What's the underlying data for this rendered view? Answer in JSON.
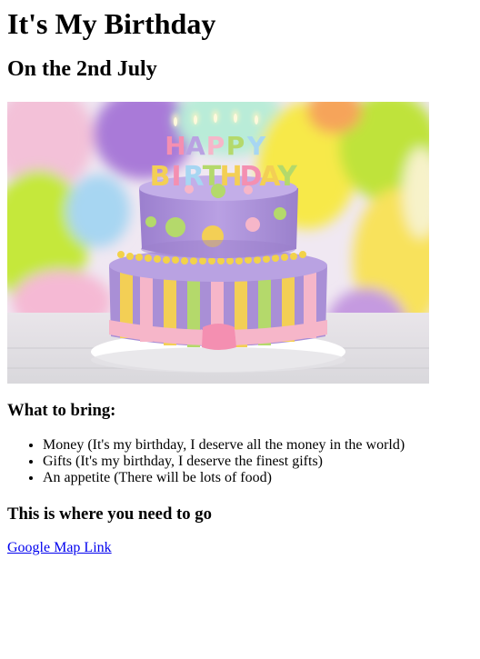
{
  "title": "It's My Birthday",
  "subtitle": "On the 2nd July",
  "image": {
    "icon": "birthday-cake-image",
    "cake_lettering": "HAPPY BIRTHDAY",
    "colors": {
      "cake_purple": "#a98fd6",
      "stripe_yellow": "#f3cf55",
      "stripe_green": "#b4d96b",
      "ribbon_pink": "#f6b6c9",
      "balloon_green": "#bfe33a",
      "balloon_purple": "#a97ad8",
      "balloon_yellow": "#f7d43a"
    }
  },
  "bring_section": {
    "heading": "What to bring:",
    "items": [
      "Money (It's my birthday, I deserve all the money in the world)",
      "Gifts (It's my birthday, I deserve the finest gifts)",
      "An appetite (There will be lots of food)"
    ]
  },
  "location_section": {
    "heading": "This is where you need to go",
    "link_text": "Google Map Link"
  }
}
